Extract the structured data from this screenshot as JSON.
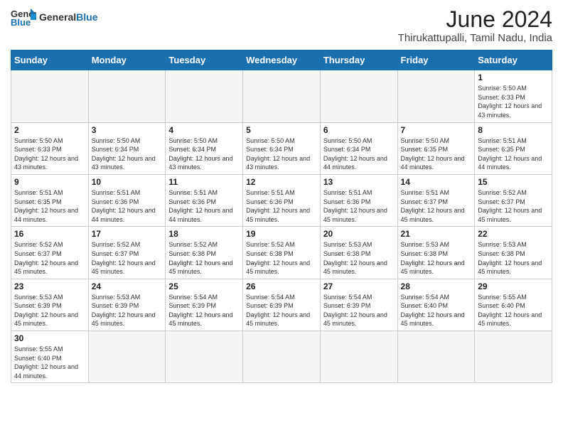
{
  "header": {
    "logo_general": "General",
    "logo_blue": "Blue",
    "title": "June 2024",
    "location": "Thirukattupalli, Tamil Nadu, India"
  },
  "weekdays": [
    "Sunday",
    "Monday",
    "Tuesday",
    "Wednesday",
    "Thursday",
    "Friday",
    "Saturday"
  ],
  "weeks": [
    [
      {
        "day": "",
        "empty": true
      },
      {
        "day": "",
        "empty": true
      },
      {
        "day": "",
        "empty": true
      },
      {
        "day": "",
        "empty": true
      },
      {
        "day": "",
        "empty": true
      },
      {
        "day": "",
        "empty": true
      },
      {
        "day": "1",
        "sunrise": "5:50 AM",
        "sunset": "6:33 PM",
        "daylight": "12 hours and 43 minutes."
      }
    ],
    [
      {
        "day": "2",
        "sunrise": "5:50 AM",
        "sunset": "6:33 PM",
        "daylight": "12 hours and 43 minutes."
      },
      {
        "day": "3",
        "sunrise": "5:50 AM",
        "sunset": "6:34 PM",
        "daylight": "12 hours and 43 minutes."
      },
      {
        "day": "4",
        "sunrise": "5:50 AM",
        "sunset": "6:34 PM",
        "daylight": "12 hours and 43 minutes."
      },
      {
        "day": "5",
        "sunrise": "5:50 AM",
        "sunset": "6:34 PM",
        "daylight": "12 hours and 43 minutes."
      },
      {
        "day": "6",
        "sunrise": "5:50 AM",
        "sunset": "6:34 PM",
        "daylight": "12 hours and 44 minutes."
      },
      {
        "day": "7",
        "sunrise": "5:50 AM",
        "sunset": "6:35 PM",
        "daylight": "12 hours and 44 minutes."
      },
      {
        "day": "8",
        "sunrise": "5:51 AM",
        "sunset": "6:35 PM",
        "daylight": "12 hours and 44 minutes."
      }
    ],
    [
      {
        "day": "9",
        "sunrise": "5:51 AM",
        "sunset": "6:35 PM",
        "daylight": "12 hours and 44 minutes."
      },
      {
        "day": "10",
        "sunrise": "5:51 AM",
        "sunset": "6:36 PM",
        "daylight": "12 hours and 44 minutes."
      },
      {
        "day": "11",
        "sunrise": "5:51 AM",
        "sunset": "6:36 PM",
        "daylight": "12 hours and 44 minutes."
      },
      {
        "day": "12",
        "sunrise": "5:51 AM",
        "sunset": "6:36 PM",
        "daylight": "12 hours and 45 minutes."
      },
      {
        "day": "13",
        "sunrise": "5:51 AM",
        "sunset": "6:36 PM",
        "daylight": "12 hours and 45 minutes."
      },
      {
        "day": "14",
        "sunrise": "5:51 AM",
        "sunset": "6:37 PM",
        "daylight": "12 hours and 45 minutes."
      },
      {
        "day": "15",
        "sunrise": "5:52 AM",
        "sunset": "6:37 PM",
        "daylight": "12 hours and 45 minutes."
      }
    ],
    [
      {
        "day": "16",
        "sunrise": "5:52 AM",
        "sunset": "6:37 PM",
        "daylight": "12 hours and 45 minutes."
      },
      {
        "day": "17",
        "sunrise": "5:52 AM",
        "sunset": "6:37 PM",
        "daylight": "12 hours and 45 minutes."
      },
      {
        "day": "18",
        "sunrise": "5:52 AM",
        "sunset": "6:38 PM",
        "daylight": "12 hours and 45 minutes."
      },
      {
        "day": "19",
        "sunrise": "5:52 AM",
        "sunset": "6:38 PM",
        "daylight": "12 hours and 45 minutes."
      },
      {
        "day": "20",
        "sunrise": "5:53 AM",
        "sunset": "6:38 PM",
        "daylight": "12 hours and 45 minutes."
      },
      {
        "day": "21",
        "sunrise": "5:53 AM",
        "sunset": "6:38 PM",
        "daylight": "12 hours and 45 minutes."
      },
      {
        "day": "22",
        "sunrise": "5:53 AM",
        "sunset": "6:38 PM",
        "daylight": "12 hours and 45 minutes."
      }
    ],
    [
      {
        "day": "23",
        "sunrise": "5:53 AM",
        "sunset": "6:39 PM",
        "daylight": "12 hours and 45 minutes."
      },
      {
        "day": "24",
        "sunrise": "5:53 AM",
        "sunset": "6:39 PM",
        "daylight": "12 hours and 45 minutes."
      },
      {
        "day": "25",
        "sunrise": "5:54 AM",
        "sunset": "6:39 PM",
        "daylight": "12 hours and 45 minutes."
      },
      {
        "day": "26",
        "sunrise": "5:54 AM",
        "sunset": "6:39 PM",
        "daylight": "12 hours and 45 minutes."
      },
      {
        "day": "27",
        "sunrise": "5:54 AM",
        "sunset": "6:39 PM",
        "daylight": "12 hours and 45 minutes."
      },
      {
        "day": "28",
        "sunrise": "5:54 AM",
        "sunset": "6:40 PM",
        "daylight": "12 hours and 45 minutes."
      },
      {
        "day": "29",
        "sunrise": "5:55 AM",
        "sunset": "6:40 PM",
        "daylight": "12 hours and 45 minutes."
      }
    ],
    [
      {
        "day": "30",
        "sunrise": "5:55 AM",
        "sunset": "6:40 PM",
        "daylight": "12 hours and 44 minutes."
      },
      {
        "day": "",
        "empty": true
      },
      {
        "day": "",
        "empty": true
      },
      {
        "day": "",
        "empty": true
      },
      {
        "day": "",
        "empty": true
      },
      {
        "day": "",
        "empty": true
      },
      {
        "day": "",
        "empty": true
      }
    ]
  ]
}
